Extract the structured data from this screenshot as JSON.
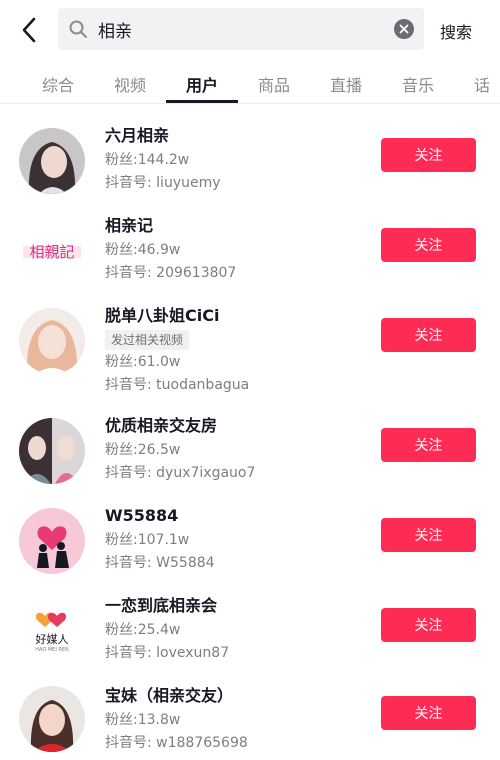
{
  "search": {
    "query": "相亲",
    "submit_label": "搜索"
  },
  "tabs": [
    {
      "label": "综合"
    },
    {
      "label": "视频"
    },
    {
      "label": "用户",
      "active": true
    },
    {
      "label": "商品"
    },
    {
      "label": "直播"
    },
    {
      "label": "音乐"
    },
    {
      "label": "话"
    }
  ],
  "users": [
    {
      "name": "六月相亲",
      "fans": "粉丝:144.2w",
      "id": "抖音号: liuyuemy",
      "follow": "关注"
    },
    {
      "name": "相亲记",
      "fans": "粉丝:46.9w",
      "id": "抖音号: 209613807",
      "follow": "关注",
      "logo_text": "相親記"
    },
    {
      "name": "脱单八卦姐CiCi",
      "tag": "发过相关视频",
      "fans": "粉丝:61.0w",
      "id": "抖音号: tuodanbagua",
      "follow": "关注"
    },
    {
      "name": "优质相亲交友房",
      "fans": "粉丝:26.5w",
      "id": "抖音号: dyux7ixgauo7",
      "follow": "关注"
    },
    {
      "name": "W55884",
      "fans": "粉丝:107.1w",
      "id": "抖音号: W55884",
      "follow": "关注"
    },
    {
      "name": "一恋到底相亲会",
      "fans": "粉丝:25.4w",
      "id": "抖音号: lovexun87",
      "follow": "关注",
      "logo_text": "好媒人",
      "logo_sub": "HAO MEI REN"
    },
    {
      "name": "宝妹（相亲交友）",
      "fans": "粉丝:13.8w",
      "id": "抖音号: w188765698",
      "follow": "关注"
    }
  ],
  "colors": {
    "accent": "#fe2c55",
    "text": "#161823",
    "muted": "#7d7e84"
  }
}
